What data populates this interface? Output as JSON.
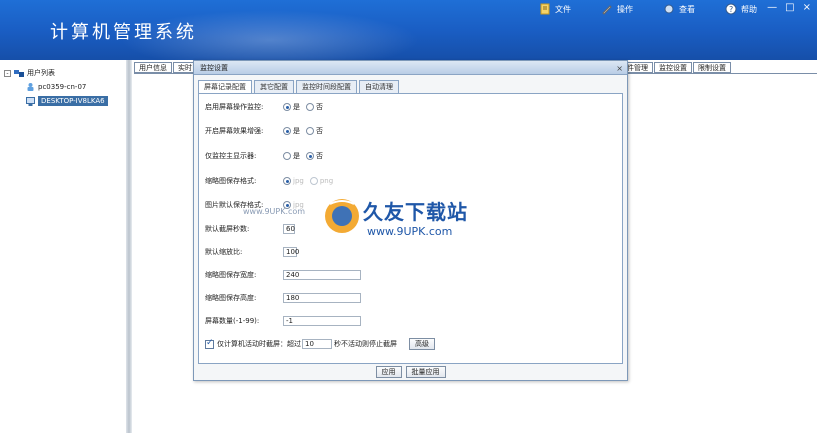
{
  "app": {
    "title": "计算机管理系统"
  },
  "topmenu": [
    {
      "label": "文件",
      "icon": "file-icon"
    },
    {
      "label": "操作",
      "icon": "tools-icon"
    },
    {
      "label": "查看",
      "icon": "view-icon"
    },
    {
      "label": "帮助",
      "icon": "help-icon"
    }
  ],
  "window_controls": {
    "minimize": "—",
    "maximize": "□",
    "close": "×"
  },
  "tree": {
    "root": "用户列表",
    "items": [
      "pc0359-cn-07",
      "DESKTOP-IV8LKA6"
    ]
  },
  "back_tabs_left": [
    "用户信息",
    "实时"
  ],
  "back_tabs_right": [
    "件管理",
    "监控设置",
    "限制设置"
  ],
  "dialog": {
    "title": "监控设置",
    "close": "×",
    "tabs": [
      "屏幕记录配置",
      "其它配置",
      "监控时间段配置",
      "自动清理"
    ],
    "active_tab": 0,
    "rows": {
      "enable_screen": {
        "label": "启用屏幕操作监控:",
        "opt1": "是",
        "opt2": "否"
      },
      "enable_special": {
        "label": "开启屏幕效果增强:",
        "opt1": "是",
        "opt2": "否"
      },
      "main_monitor": {
        "label": "仅监控主显示器:",
        "opt1": "是",
        "opt2": "否"
      },
      "thumb_format": {
        "label": "缩略图保存格式:",
        "opt1": "jpg",
        "opt2": "png"
      },
      "image_format": {
        "label": "图片默认保存格式:",
        "opt1": "jpg"
      },
      "interval": {
        "label": "默认截屏秒数:",
        "value": "60"
      },
      "scale": {
        "label": "默认缩放比:",
        "value": "100"
      },
      "thumb_width": {
        "label": "缩略图保存宽度:",
        "value": "240"
      },
      "thumb_height": {
        "label": "缩略图保存高度:",
        "value": "180"
      },
      "screen_count": {
        "label": "屏幕数量(-1-99):",
        "value": "-1"
      }
    },
    "idle": {
      "text_before": "仅计算机活动时截屏：超过",
      "value": "10",
      "text_after": "秒不活动则停止截屏",
      "advanced": "高级"
    },
    "buttons": {
      "apply": "应用",
      "batch_apply": "批量应用"
    }
  },
  "watermark": {
    "brand": "久友下载站",
    "url": "www.9UPK.com",
    "url_left": "www.9UPK.com"
  },
  "colors": {
    "header": "#1a5ec4",
    "selection": "#3a6ea5",
    "accent": "#2a5fa8"
  }
}
